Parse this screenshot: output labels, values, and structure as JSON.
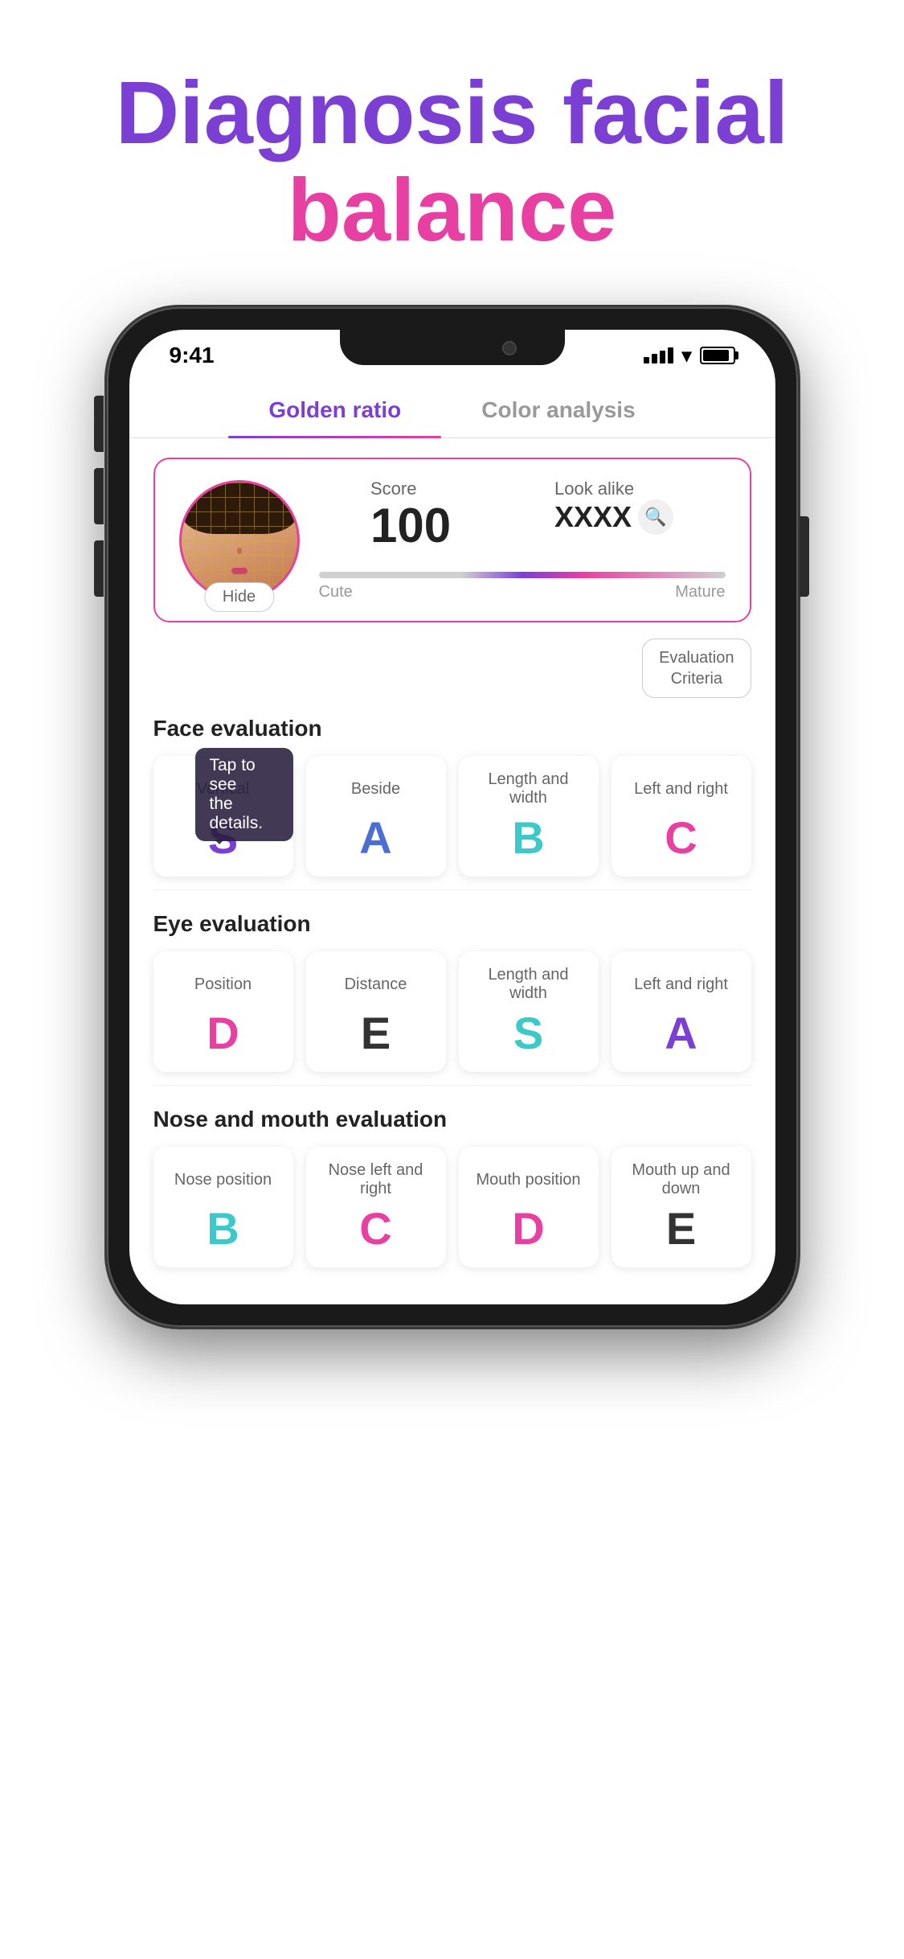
{
  "title": {
    "line1_purple": "Diagnosis facial",
    "line1_pink": "balance",
    "gradient_start": "#7B3FD4",
    "gradient_end": "#E83FA3"
  },
  "phone": {
    "status_time": "9:41",
    "tabs": [
      {
        "label": "Golden ratio",
        "active": true
      },
      {
        "label": "Color analysis",
        "active": false
      }
    ],
    "score_card": {
      "score_label": "Score",
      "score_value": "100",
      "look_alike_label": "Look alike",
      "look_alike_value": "XXXX",
      "hide_label": "Hide",
      "cute_label": "Cute",
      "mature_label": "Mature"
    },
    "eval_criteria_label": "Evaluation\nCriteria",
    "tooltip": "Tap to see\nthe details.",
    "face_evaluation": {
      "section_title": "Face evaluation",
      "cards": [
        {
          "label": "Vertical",
          "grade": "S",
          "color": "purple"
        },
        {
          "label": "Beside",
          "grade": "A",
          "color": "blue"
        },
        {
          "label": "Length and width",
          "grade": "B",
          "color": "cyan"
        },
        {
          "label": "Left and right",
          "grade": "C",
          "color": "pink"
        }
      ]
    },
    "eye_evaluation": {
      "section_title": "Eye evaluation",
      "cards": [
        {
          "label": "Position",
          "grade": "D",
          "color": "pink"
        },
        {
          "label": "Distance",
          "grade": "E",
          "color": "dark"
        },
        {
          "label": "Length and width",
          "grade": "S",
          "color": "cyan"
        },
        {
          "label": "Left and right",
          "grade": "A",
          "color": "purple"
        }
      ]
    },
    "nose_mouth_evaluation": {
      "section_title": "Nose and mouth evaluation",
      "cards": [
        {
          "label": "Nose position",
          "grade": "B",
          "color": "cyan"
        },
        {
          "label": "Nose left and right",
          "grade": "C",
          "color": "pink"
        },
        {
          "label": "Mouth position",
          "grade": "D",
          "color": "pink"
        },
        {
          "label": "Mouth up and down",
          "grade": "E",
          "color": "dark"
        }
      ]
    }
  }
}
